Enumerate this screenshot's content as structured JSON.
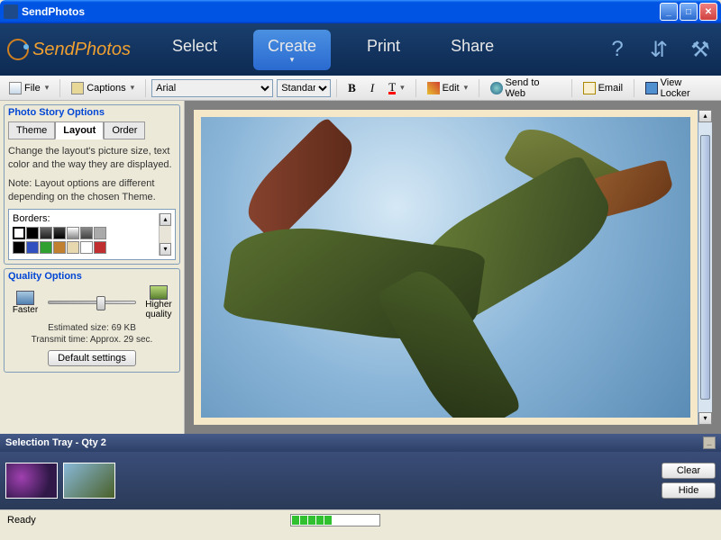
{
  "window": {
    "title": "SendPhotos"
  },
  "brand": {
    "name": "SendPhotos"
  },
  "nav": {
    "tabs": [
      {
        "label": "Select"
      },
      {
        "label": "Create"
      },
      {
        "label": "Print"
      },
      {
        "label": "Share"
      }
    ],
    "active_index": 1
  },
  "toolbar": {
    "file_label": "File",
    "captions_label": "Captions",
    "font_value": "Arial",
    "size_value": "Standard",
    "edit_label": "Edit",
    "send_web_label": "Send to Web",
    "email_label": "Email",
    "view_locker_label": "View Locker"
  },
  "sidebar": {
    "story_title": "Photo Story Options",
    "tabs": [
      {
        "label": "Theme"
      },
      {
        "label": "Layout"
      },
      {
        "label": "Order"
      }
    ],
    "active_tab": 1,
    "desc_line1": "Change the layout's picture size, text color and the way they are displayed.",
    "desc_line2": "Note: Layout options are different depending on the chosen Theme.",
    "borders_label": "Borders:",
    "border_colors_row1": [
      "#ffffff",
      "#000000",
      "#666666",
      "#444444",
      "#ffffff",
      "#888888",
      "#aaaaaa"
    ],
    "border_colors_row2": [
      "#000000",
      "#3050c0",
      "#30a030",
      "#c08030",
      "#e8d8b0",
      "#ffffff",
      "#c03030"
    ],
    "quality_title": "Quality Options",
    "faster_label": "Faster",
    "higher_label": "Higher quality",
    "est_size": "Estimated size: 69 KB",
    "transmit": "Transmit time: Approx. 29 sec.",
    "default_btn": "Default settings"
  },
  "tray": {
    "header": "Selection Tray - Qty 2",
    "clear_label": "Clear",
    "hide_label": "Hide"
  },
  "status": {
    "text": "Ready"
  }
}
